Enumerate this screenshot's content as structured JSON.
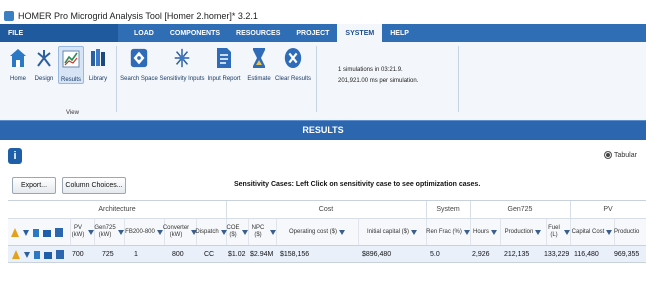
{
  "window": {
    "title": "HOMER Pro Microgrid Analysis Tool [Homer 2.homer]* 3.2.1"
  },
  "ribbon_tabs": {
    "file": "FILE",
    "tabs": [
      "LOAD",
      "COMPONENTS",
      "RESOURCES",
      "PROJECT",
      "SYSTEM",
      "HELP"
    ],
    "active": "SYSTEM"
  },
  "ribbon": {
    "buttons": [
      {
        "label": "Home",
        "icon": "home-icon"
      },
      {
        "label": "Design",
        "icon": "design-icon"
      },
      {
        "label": "Results",
        "icon": "results-icon"
      },
      {
        "label": "Library",
        "icon": "library-icon"
      },
      {
        "label": "Search Space",
        "icon": "search-space-icon"
      },
      {
        "label": "Sensitivity Inputs",
        "icon": "sensitivity-inputs-icon"
      },
      {
        "label": "Input Report",
        "icon": "input-report-icon"
      },
      {
        "label": "Estimate",
        "icon": "estimate-icon"
      },
      {
        "label": "Clear Results",
        "icon": "clear-results-icon"
      }
    ],
    "view_group_label": "View",
    "status_line1": "1 simulations in 03:21.9.",
    "status_line2": "201,921.00 ms per simulation."
  },
  "results": {
    "title": "RESULTS",
    "tabular_label": "Tabular",
    "export_label": "Export...",
    "column_choices_label": "Column Choices...",
    "sensitivity_text": "Sensitivity Cases: Left Click on sensitivity case to see optimization cases."
  },
  "table": {
    "groups": [
      "Architecture",
      "Cost",
      "System",
      "Gen725",
      "PV"
    ],
    "headers": {
      "pv": "PV (kW)",
      "gen725": "Gen725 (kW)",
      "fb200": "FB200-800",
      "converter": "Converter (kW)",
      "dispatch": "Dispatch",
      "coe": "COE ($)",
      "npc": "NPC ($)",
      "operating_cost": "Operating cost ($)",
      "initial_capital": "Initial capital ($)",
      "ren_frac": "Ren Frac (%)",
      "hours": "Hours",
      "production": "Production",
      "fuel": "Fuel (L)",
      "capital_cost": "Capital Cost",
      "production_pv": "Productio"
    },
    "row": {
      "pv": "700",
      "gen725": "725",
      "fb200": "1",
      "converter": "800",
      "dispatch": "CC",
      "coe": "$1.02",
      "npc": "$2.94M",
      "operating_cost": "$158,156",
      "initial_capital": "$896,480",
      "ren_frac": "5.0",
      "hours": "2,926",
      "production": "212,135",
      "fuel": "133,229",
      "capital_cost": "116,480",
      "production_pv": "969,355"
    }
  },
  "colors": {
    "ribbon_blue": "#2f6db5",
    "results_bar": "#2b66ae",
    "row_highlight": "#e9f0fa"
  }
}
